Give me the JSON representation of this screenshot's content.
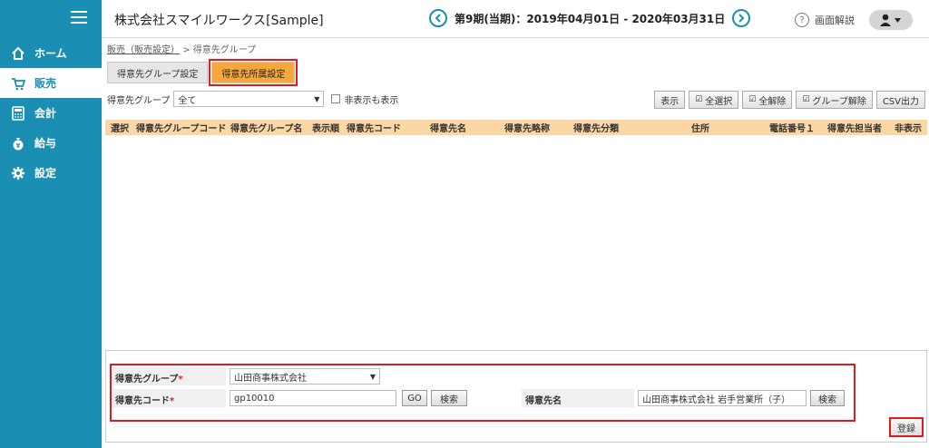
{
  "sidebar": {
    "items": [
      {
        "label": "ホーム",
        "icon": "home-icon",
        "active": false
      },
      {
        "label": "販売",
        "icon": "cart-icon",
        "active": true
      },
      {
        "label": "会計",
        "icon": "calculator-icon",
        "active": false
      },
      {
        "label": "給与",
        "icon": "money-bag-icon",
        "active": false
      },
      {
        "label": "設定",
        "icon": "gear-icon",
        "active": false
      }
    ]
  },
  "header": {
    "company": "株式会社スマイルワークス[Sample]",
    "period": "第9期(当期)：2019年04月01日 - 2020年03月31日",
    "help_label": "画面解説"
  },
  "breadcrumb": {
    "parent": "販売（販売設定）",
    "separator": ">",
    "current": "得意先グループ"
  },
  "tabs": [
    {
      "label": "得意先グループ設定",
      "active": false
    },
    {
      "label": "得意先所属設定",
      "active": true
    }
  ],
  "filter": {
    "label": "得意先グループ",
    "value": "全て",
    "checkbox_label": "非表示も表示"
  },
  "toolbar": {
    "display": "表示",
    "select_all": "全選択",
    "deselect_all": "全解除",
    "group_release": "グループ解除",
    "csv": "CSV出力"
  },
  "table": {
    "headers": [
      "選択",
      "得意先グループコード",
      "得意先グループ名",
      "表示順",
      "得意先コード",
      "得意先名",
      "得意先略称",
      "得意先分類",
      "住所",
      "電話番号１",
      "得意先担当者",
      "非表示"
    ]
  },
  "form": {
    "group_label": "得意先グループ",
    "group_value": "山田商事株式会社",
    "code_label": "得意先コード",
    "code_value": "gp10010",
    "go_label": "GO",
    "search_label": "検索",
    "name_label": "得意先名",
    "name_value": "山田商事株式会社 岩手営業所（子）",
    "search2_label": "検索",
    "required_mark": "*"
  },
  "register_label": "登録",
  "colors": {
    "sidebar": "#1b8fb3",
    "active_tab": "#f6a83b",
    "table_header": "#fad7a4",
    "highlight": "#e01b1b"
  }
}
